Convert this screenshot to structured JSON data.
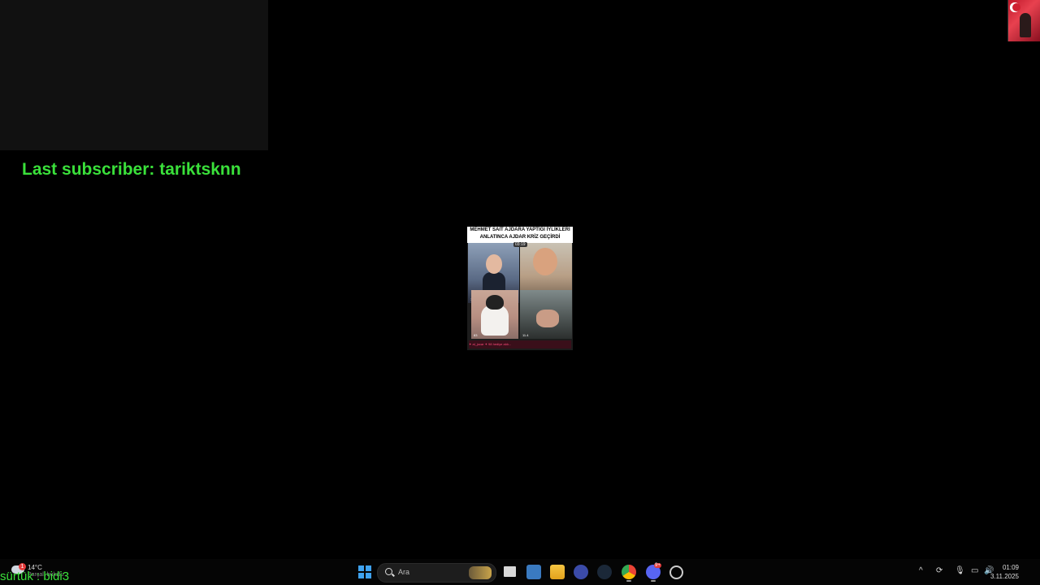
{
  "overlay": {
    "last_subscriber": "Last subscriber: tariktsknn",
    "bottom_text": "sürtük : bidi3"
  },
  "video": {
    "header_line1": "MEHMET SAİT AJDARA YAPTIĞI İYLİKLERİ",
    "header_line2": "ANLATINCA AJDAR KRİZ GEÇİRDİ",
    "timer": "03:19",
    "tile1_label": "104",
    "tile2_label": "23k",
    "tile3_label": "83",
    "tile4_label": "11.4",
    "chat_text": "✦ al_jucar ✦ 98 hediye aldı..."
  },
  "taskbar": {
    "weather_temp": "14°C",
    "weather_cond": "Parçalı bulutlu",
    "weather_badge": "1",
    "search_placeholder": "Ara",
    "time": "01:09",
    "date": "3.11.2025",
    "discord_badge": "9+"
  },
  "colors": {
    "overlay_green": "#3ae03a",
    "background": "#000000",
    "taskbar": "#050505",
    "windows_blue": "#3fa3f0"
  }
}
